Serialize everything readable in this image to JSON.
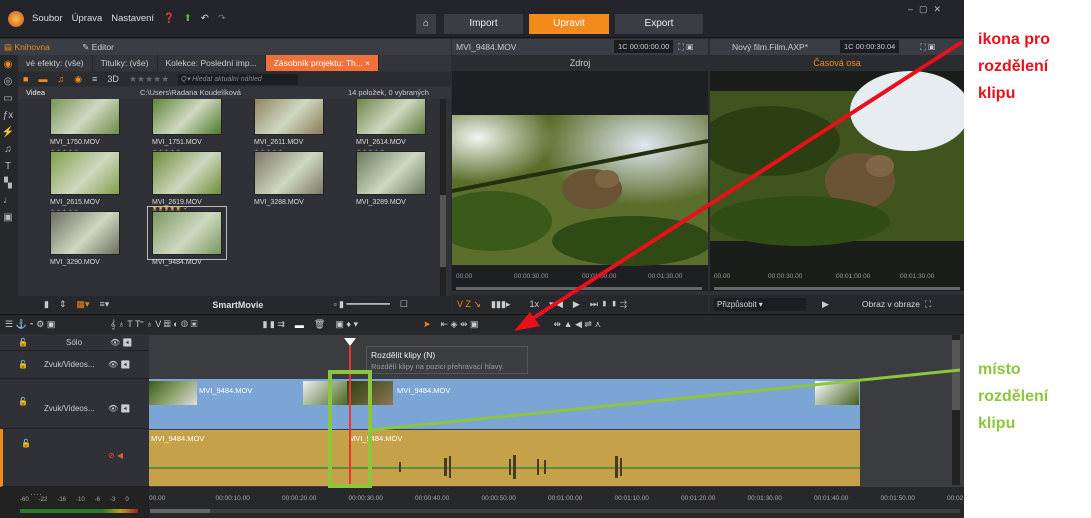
{
  "menu": {
    "items": [
      "Soubor",
      "Úprava",
      "Nastavení"
    ]
  },
  "nav": {
    "import": "Import",
    "edit": "Upravit",
    "export": "Export"
  },
  "library": {
    "tab_library": "Knihovna",
    "tab_editor": "Editor",
    "tabs": [
      "vé efekty: (vše)",
      "Titulky: (vše)",
      "Kolekce: Poslední imp...",
      "Zásobník projektu: Th... ×"
    ],
    "search_placeholder": "Hledat aktuální náhled",
    "folder": "Videa",
    "path": "C:\\Users\\Radana Koudelíková",
    "count": "14 položek, 0 vybraných",
    "clips": [
      {
        "name": "MVI_1750.MOV",
        "stars": "★★★★★"
      },
      {
        "name": "MVI_1751.MOV",
        "stars": "★★★★★"
      },
      {
        "name": "MVI_2611.MOV",
        "stars": "★★★★★"
      },
      {
        "name": "MVI_2614.MOV",
        "stars": "★★★★★"
      },
      {
        "name": "MVI_2615.MOV",
        "stars": "★★★★★"
      },
      {
        "name": "MVI_2619.MOV",
        "stars": "★★★★★"
      },
      {
        "name": "MVI_3288.MOV",
        "stars": ""
      },
      {
        "name": "MVI_3289.MOV",
        "stars": ""
      },
      {
        "name": "MVI_3290.MOV",
        "stars": ""
      },
      {
        "name": "MVI_9484.MOV",
        "stars": "★★★★★ ✓"
      }
    ],
    "smartmovie": "SmartMovie"
  },
  "source_monitor": {
    "file": "MVI_9484.MOV",
    "timecode": "00:00:00.00",
    "tab": "Zdroj",
    "ruler": [
      "00.00",
      "00:00:30.00",
      "00:01:00.00",
      "00:01:30.00"
    ],
    "speed": "1x"
  },
  "timeline_monitor": {
    "file": "Nový film.Film.AXP*",
    "timecode": "00:00:30.04",
    "tab": "Časová osa",
    "ruler": [
      "00.00",
      "00:00:30.00",
      "00:01:00.00",
      "00:01:30.00"
    ],
    "fit": "Přizpůsobit",
    "pip": "Obraz v obraze"
  },
  "timeline": {
    "tracks": [
      {
        "name": "Sólo"
      },
      {
        "name": "Zvuk/Videos..."
      },
      {
        "name": "Zvuk/Videos..."
      },
      {
        "name": ""
      }
    ],
    "tooltip_title": "Rozdělit klipy (N)",
    "tooltip_text": "Rozdělí klipy na pozici přehrávací hlavy.",
    "clip_name": "MVI_9484.MOV",
    "ruler": [
      "00.00",
      "00:00:10.00",
      "00:00:20.00",
      "00:00:30.00",
      "00:00:40.00",
      "00:00:50.00",
      "00:01:00.00",
      "00:01:10.00",
      "00:01:20.00",
      "00:01:30.00",
      "00:01:40.00",
      "00:01:50.00",
      "00:02"
    ],
    "meter": [
      "-60",
      "-22",
      "-16",
      "-10",
      "-6",
      "-3",
      "0"
    ]
  },
  "annotations": {
    "split_icon": [
      "ikona pro",
      "rozdělení",
      "klipu"
    ],
    "split_place": [
      "místo",
      "rozdělení",
      "klipu"
    ],
    "colors": {
      "red": "#e8101a",
      "green": "#8cc63f",
      "accent": "#f28a1c"
    }
  }
}
